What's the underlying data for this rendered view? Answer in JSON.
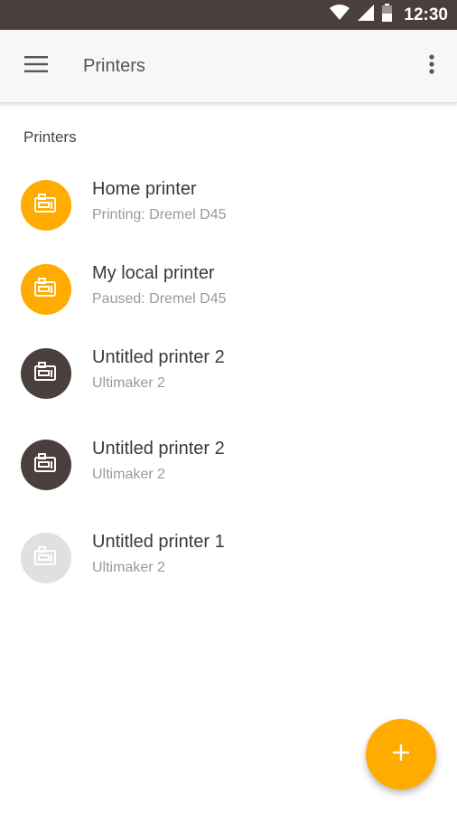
{
  "status_bar": {
    "time": "12:30",
    "icons": [
      "wifi-icon",
      "signal-icon",
      "battery-icon"
    ]
  },
  "app_bar": {
    "title": "Printers",
    "menu_icon": "menu-icon",
    "overflow_icon": "more-vert-icon"
  },
  "section": {
    "header": "Printers"
  },
  "printers": [
    {
      "name": "Home printer",
      "status": "Printing: Dremel D45",
      "avatar_color": "#ffab00",
      "icon": "printer-icon"
    },
    {
      "name": "My local printer",
      "status": "Paused: Dremel D45",
      "avatar_color": "#ffab00",
      "icon": "printer-icon"
    },
    {
      "name": "Untitled printer 2",
      "status": "Ultimaker 2",
      "avatar_color": "#4b3f3e",
      "icon": "printer-icon"
    },
    {
      "name": "Untitled printer 2",
      "status": "Ultimaker 2",
      "avatar_color": "#4b3f3e",
      "icon": "printer-icon"
    },
    {
      "name": "Untitled printer 1",
      "status": "Ultimaker 2",
      "avatar_color": "#e0e0e0",
      "icon": "printer-icon"
    }
  ],
  "fab": {
    "icon": "add-icon",
    "color": "#ffab00"
  },
  "colors": {
    "status_bar": "#4b3f3e",
    "accent": "#ffab00"
  }
}
